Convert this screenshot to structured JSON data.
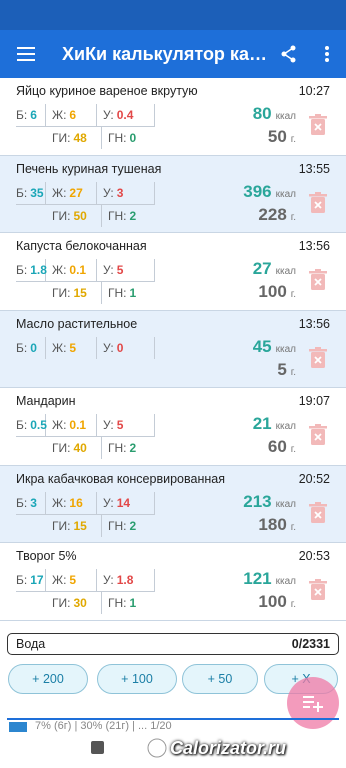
{
  "app_bar": {
    "title": "ХиКи калькулятор кал...",
    "icons": [
      "menu-icon",
      "share-icon",
      "more-vert-icon"
    ],
    "color": "#1e6fd9"
  },
  "macro_labels": {
    "b": "Б:",
    "z": "Ж:",
    "u": "У:",
    "gi": "ГИ:",
    "gn": "ГН:"
  },
  "units": {
    "kcal": "ккал",
    "gram": "г."
  },
  "entries": [
    {
      "name": "Яйцо куриное вареное вкрутую",
      "time": "10:27",
      "b": "6",
      "z": "6",
      "u": "0.4",
      "gi": "48",
      "gn": "0",
      "kcal": "80",
      "grams": "50"
    },
    {
      "name": "Печень куриная тушеная",
      "time": "13:55",
      "b": "35",
      "z": "27",
      "u": "3",
      "gi": "50",
      "gn": "2",
      "kcal": "396",
      "grams": "228"
    },
    {
      "name": "Капуста белокочанная",
      "time": "13:56",
      "b": "1.8",
      "z": "0.1",
      "u": "5",
      "gi": "15",
      "gn": "1",
      "kcal": "27",
      "grams": "100"
    },
    {
      "name": "Масло растительное",
      "time": "13:56",
      "b": "0",
      "z": "5",
      "u": "0",
      "gi": "",
      "gn": "",
      "kcal": "45",
      "grams": "5"
    },
    {
      "name": "Мандарин",
      "time": "19:07",
      "b": "0.5",
      "z": "0.1",
      "u": "5",
      "gi": "40",
      "gn": "2",
      "kcal": "21",
      "grams": "60"
    },
    {
      "name": "Икра кабачковая консервированная",
      "time": "20:52",
      "b": "3",
      "z": "16",
      "u": "14",
      "gi": "15",
      "gn": "2",
      "kcal": "213",
      "grams": "180"
    },
    {
      "name": "Творог 5%",
      "time": "20:53",
      "b": "17",
      "z": "5",
      "u": "1.8",
      "gi": "30",
      "gn": "1",
      "kcal": "121",
      "grams": "100"
    }
  ],
  "water": {
    "label": "Вода",
    "amount": "0/2331",
    "buttons": [
      "+ 200",
      "+ 100",
      "+ 50",
      "+ X"
    ]
  },
  "partial_summary": "7% (6г)   |   30% (21г)   |   ...   1/20",
  "watermark": "Calorizator.ru",
  "colors": {
    "protein": "#1aa6b7",
    "fat": "#f0a500",
    "carbs": "#e24848",
    "gi": "#e0a800",
    "gn": "#2a9d6f",
    "kcal": "#2aa69a",
    "alt_row": "#e6f0fb"
  }
}
